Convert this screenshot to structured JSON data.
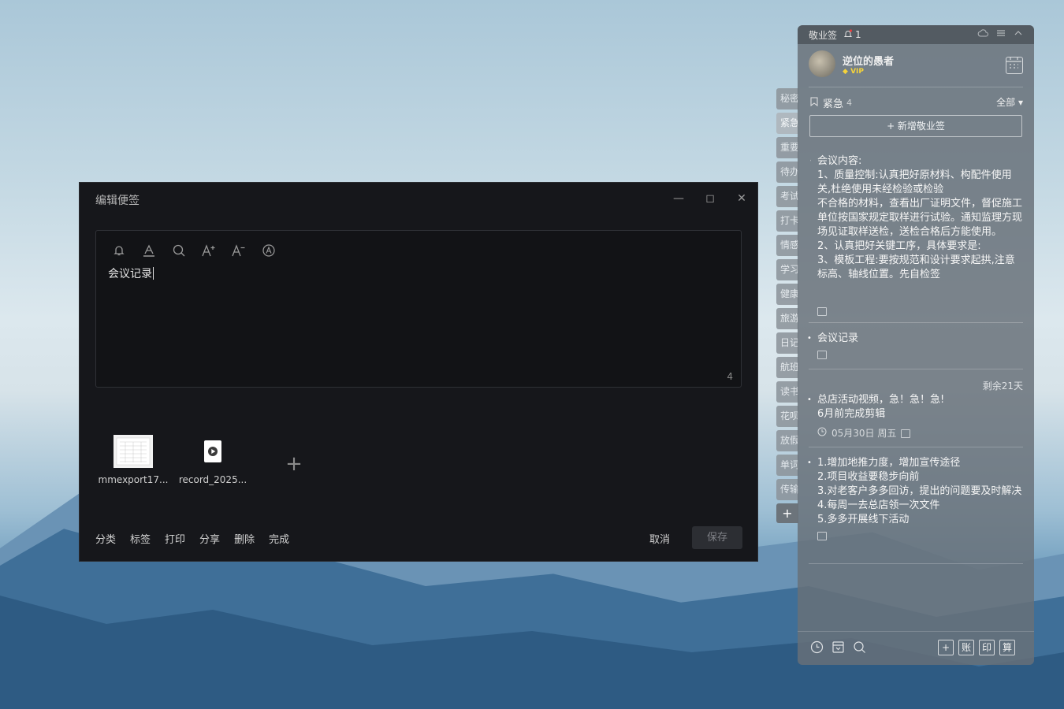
{
  "editor": {
    "title": "编辑便签",
    "window_buttons": [
      "minimize-icon",
      "maximize-icon",
      "close-icon"
    ],
    "toolbar_icons": [
      "bell-icon",
      "text-color-icon",
      "search-icon",
      "font-increase-icon",
      "font-decrease-icon",
      "auto-format-icon"
    ],
    "content": "会议记录",
    "char_count": "4",
    "attachments": [
      {
        "name": "mmexport17...",
        "icon": "image-thumbnail"
      },
      {
        "name": "record_2025...",
        "icon": "video-file-icon"
      }
    ],
    "add_attachment": "+",
    "bottom_actions": [
      "分类",
      "标签",
      "打印",
      "分享",
      "删除",
      "完成"
    ],
    "cancel": "取消",
    "save": "保存"
  },
  "side_tabs": [
    "秘密",
    "紧急",
    "重要",
    "待办",
    "考试",
    "打卡",
    "情感",
    "学习",
    "健康",
    "旅游",
    "日记",
    "航班",
    "读书",
    "花呗",
    "放假",
    "单词",
    "传输"
  ],
  "side_tab_add": "+",
  "panel": {
    "app_name": "敬业签",
    "reminder_count": "1",
    "top_icons": [
      "cloud-icon",
      "menu-icon",
      "collapse-icon"
    ],
    "user": {
      "name": "逆位的愚者",
      "badge": "VIP"
    },
    "category": {
      "name": "紧急",
      "count": "4",
      "filter": "全部 ▾"
    },
    "new_note": "+ 新增敬业签",
    "notes": [
      {
        "lines": [
          "会议内容:",
          "1、质量控制:认真把好原材料、构配件使用关,杜绝使用未经检验或检验",
          "不合格的材料，查看出厂证明文件，督促施工单位按国家规定取样进行试验。通知监理方现场见证取样送检，送检合格后方能使用。",
          "2、认真把好关键工序，具体要求是:",
          "3、模板工程:要按规范和设计要求起拱,注意标高、轴线位置。先自检签"
        ]
      },
      {
        "lines": [
          "会议记录"
        ]
      },
      {
        "remaining": "剩余21天",
        "lines": [
          "总店活动视频，急！急！急!",
          "6月前完成剪辑"
        ],
        "date": "05月30日 周五"
      },
      {
        "lines": [
          "1.增加地推力度，增加宣传途径",
          "2.项目收益要稳步向前",
          "3.对老客户多多回访，提出的问题要及时解决",
          "4.每周一去总店领一次文件",
          "5.多多开展线下活动"
        ]
      }
    ],
    "footer_left": [
      "clock-icon",
      "archive-icon",
      "search-icon"
    ],
    "footer_right": [
      "+",
      "账",
      "印",
      "算"
    ]
  }
}
